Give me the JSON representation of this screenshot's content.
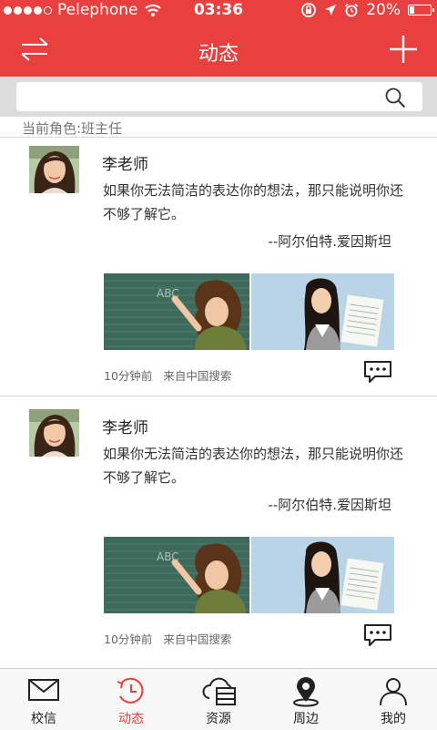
{
  "status_bar": {
    "carrier": "Pelephone",
    "time": "03:36",
    "battery": "20%",
    "battery_level": 0.2
  },
  "nav": {
    "title": "动态",
    "left_icon": "swap-arrows-icon",
    "right_icon": "plus-icon"
  },
  "search": {
    "value": "",
    "placeholder": ""
  },
  "role_label": "当前角色:班主任",
  "posts": [
    {
      "author": "李老师",
      "content": "如果你无法简洁的表达你的想法，那只能说明你还不够了解它。",
      "quote": "--阿尔伯特.爱因斯坦",
      "time": "10分钟前",
      "source": "来自中国搜索"
    },
    {
      "author": "李老师",
      "content": "如果你无法简洁的表达你的想法，那只能说明你还不够了解它。",
      "quote": "--阿尔伯特.爱因斯坦",
      "time": "10分钟前",
      "source": "来自中国搜索"
    }
  ],
  "tabs": [
    {
      "label": "校信",
      "icon": "envelope-icon"
    },
    {
      "label": "动态",
      "icon": "clock-icon",
      "active": true
    },
    {
      "label": "资源",
      "icon": "cloud-server-icon"
    },
    {
      "label": "周边",
      "icon": "location-pin-icon"
    },
    {
      "label": "我的",
      "icon": "person-icon"
    }
  ],
  "colors": {
    "accent": "#e8403e",
    "search_background": "#dcdcdc"
  }
}
